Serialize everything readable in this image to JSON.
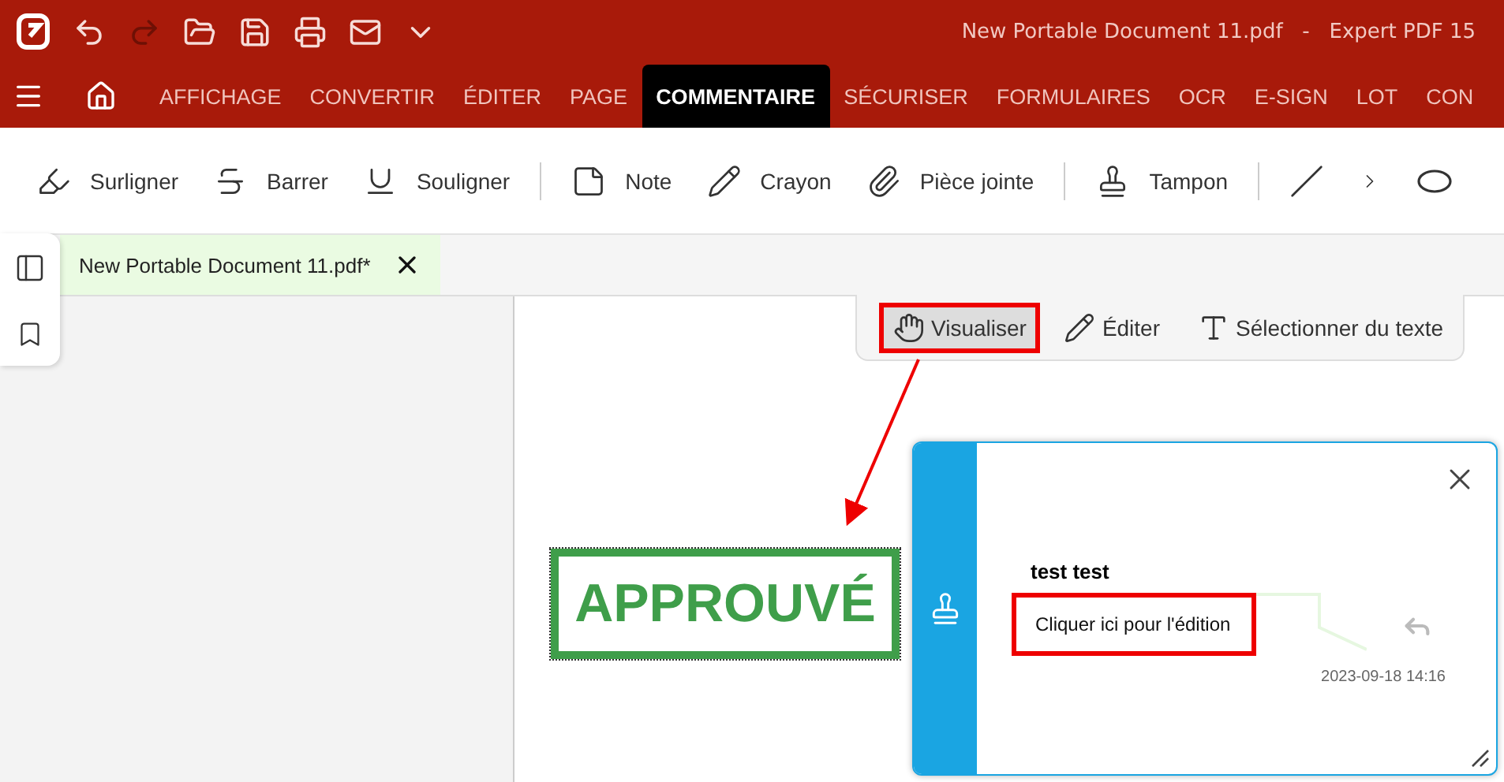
{
  "window": {
    "title": "New Portable Document 11.pdf   -   Expert PDF 15"
  },
  "quick_access": [
    {
      "kind": "undo",
      "disabled": false
    },
    {
      "kind": "redo",
      "disabled": true
    },
    {
      "kind": "open",
      "disabled": false
    },
    {
      "kind": "save",
      "disabled": false
    },
    {
      "kind": "print",
      "disabled": false
    },
    {
      "kind": "mail",
      "disabled": false
    },
    {
      "kind": "more",
      "disabled": false
    }
  ],
  "ribbon_tabs": [
    {
      "label": "AFFICHAGE",
      "selected": false
    },
    {
      "label": "CONVERTIR",
      "selected": false
    },
    {
      "label": "ÉDITER",
      "selected": false
    },
    {
      "label": "PAGE",
      "selected": false
    },
    {
      "label": "COMMENTAIRE",
      "selected": true
    },
    {
      "label": "SÉCURISER",
      "selected": false
    },
    {
      "label": "FORMULAIRES",
      "selected": false
    },
    {
      "label": "OCR",
      "selected": false
    },
    {
      "label": "E-SIGN",
      "selected": false
    },
    {
      "label": "LOT",
      "selected": false
    },
    {
      "label": "CON",
      "selected": false
    }
  ],
  "tools": [
    {
      "kind": "highlight",
      "label": "Surligner"
    },
    {
      "kind": "strike",
      "label": "Barrer"
    },
    {
      "kind": "underline",
      "label": "Souligner"
    },
    {
      "kind": "separator"
    },
    {
      "kind": "note",
      "label": "Note"
    },
    {
      "kind": "pencil",
      "label": "Crayon"
    },
    {
      "kind": "attach",
      "label": "Pièce jointe"
    },
    {
      "kind": "separator"
    },
    {
      "kind": "stamp",
      "label": "Tampon"
    },
    {
      "kind": "separator"
    },
    {
      "kind": "line"
    },
    {
      "kind": "next"
    },
    {
      "kind": "ellipse"
    }
  ],
  "document_tab": {
    "label": "New Portable Document 11.pdf*"
  },
  "view_modes": [
    {
      "kind": "hand",
      "label": "Visualiser",
      "selected": true,
      "highlighted": true
    },
    {
      "kind": "pencil",
      "label": "Éditer",
      "selected": false,
      "highlighted": false
    },
    {
      "kind": "text",
      "label": "Sélectionner du texte",
      "selected": false,
      "highlighted": false
    }
  ],
  "stamp": {
    "text": "APPROUVÉ",
    "color": "#3f9e4a"
  },
  "comment": {
    "author": "test test",
    "placeholder": "Cliquer ici pour l'édition",
    "highlighted": true,
    "date": "2023-09-18 14:16"
  }
}
